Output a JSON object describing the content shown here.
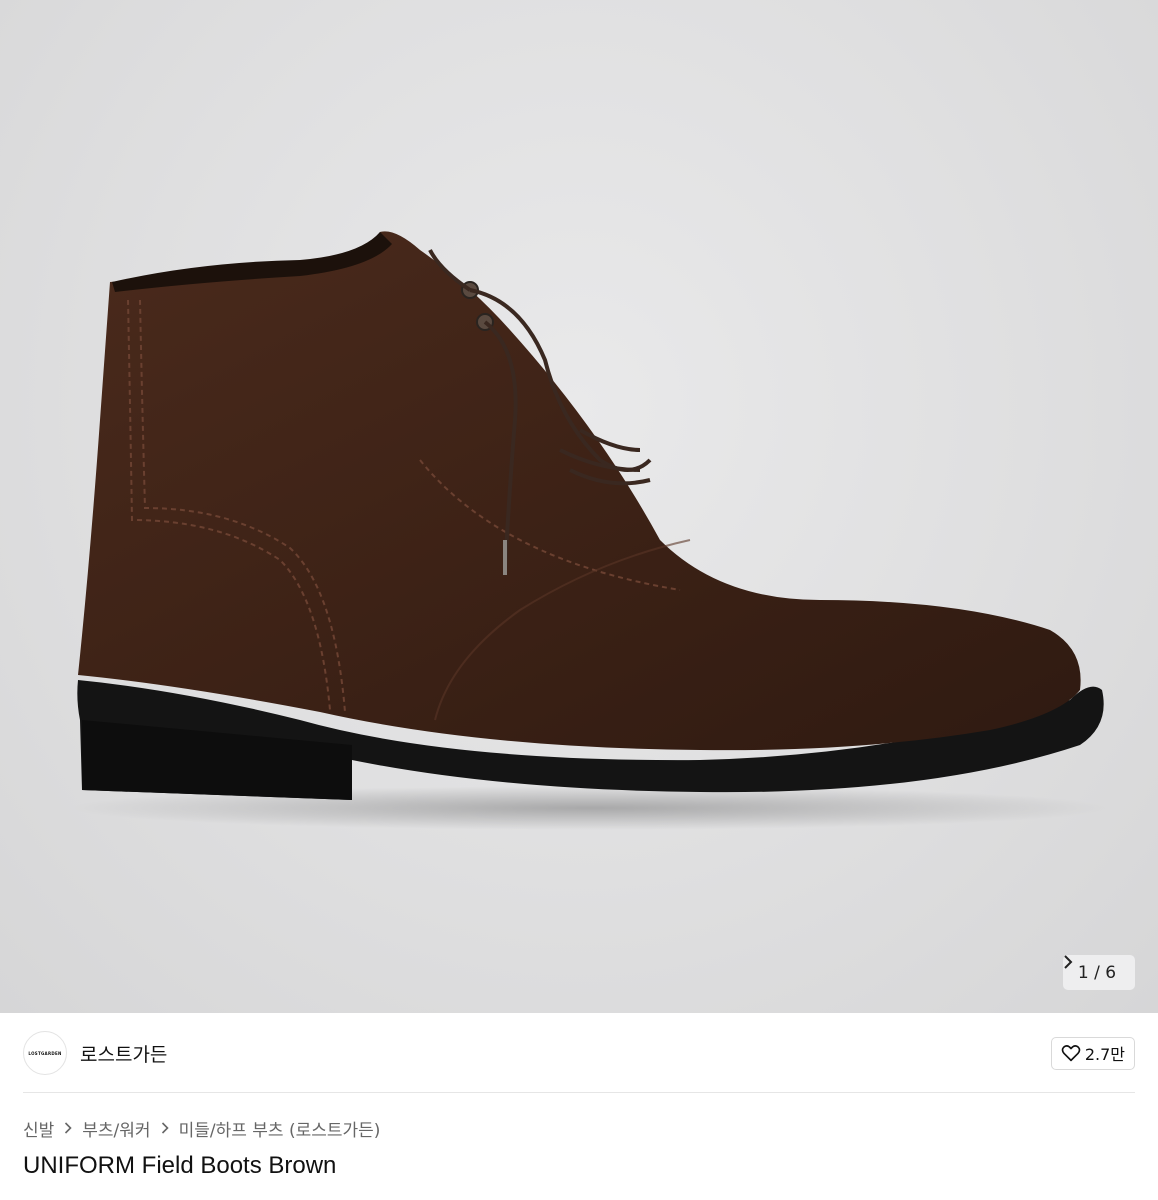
{
  "gallery": {
    "current": "1",
    "total": "6",
    "counter_text": "1 / 6"
  },
  "brand": {
    "logo_text": "LOSTGARDEN",
    "name": "로스트가든"
  },
  "likes": {
    "count": "2.7만"
  },
  "breadcrumb": {
    "items": [
      "신발",
      "부츠/워커",
      "미들/하프 부츠 (로스트가든)"
    ]
  },
  "product": {
    "title": "UNIFORM Field Boots Brown"
  },
  "colors": {
    "accent_text": "#111111",
    "muted_text": "#666666",
    "border": "#d9d9d9"
  }
}
